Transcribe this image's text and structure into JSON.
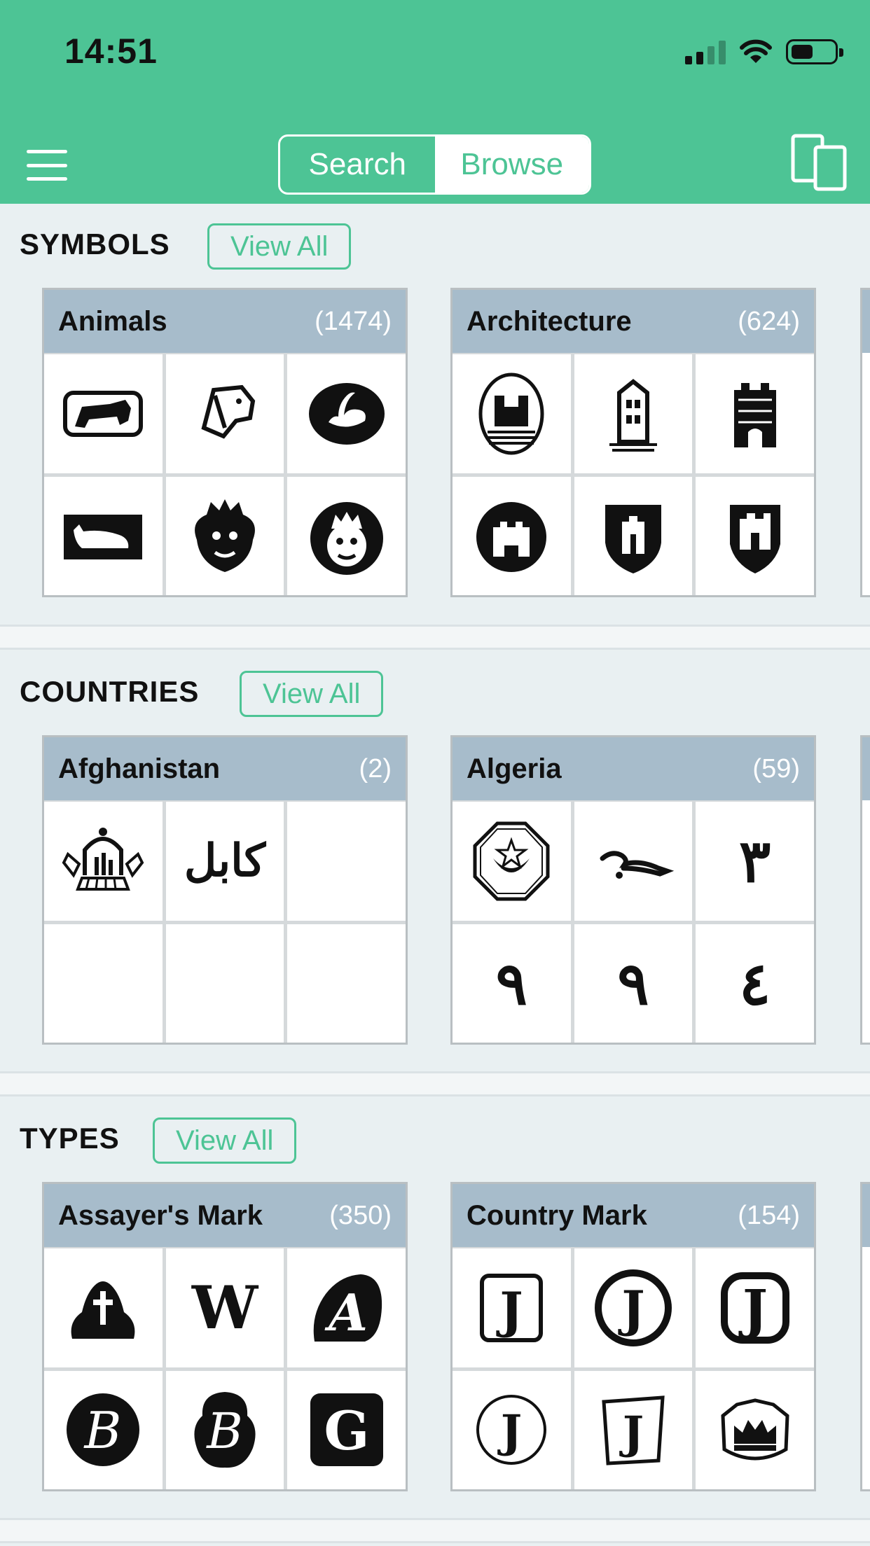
{
  "status": {
    "time": "14:51"
  },
  "header": {
    "segments": {
      "search_label": "Search",
      "browse_label": "Browse"
    }
  },
  "sections": [
    {
      "title": "SYMBOLS",
      "view_all": "View All",
      "cards": [
        {
          "name": "Animals",
          "count": "(1474)",
          "marks": [
            "lion-mark",
            "dog-head-mark",
            "swan-mark",
            "cat-mark",
            "crowned-lion-mark",
            "crowned-lion-head-mark"
          ]
        },
        {
          "name": "Architecture",
          "count": "(624)",
          "marks": [
            "towers-oval-mark",
            "building-mark",
            "castle-tower-mark",
            "castle-round-mark",
            "castle-shield-mark",
            "castle-shield-mark"
          ]
        }
      ]
    },
    {
      "title": "COUNTRIES",
      "view_all": "View All",
      "cards": [
        {
          "name": "Afghanistan",
          "count": "(2)",
          "marks": [
            "mosque-emblem-mark",
            "kabul-script-mark",
            "",
            "",
            "",
            ""
          ],
          "script_text": "كابل"
        },
        {
          "name": "Algeria",
          "count": "(59)",
          "marks": [
            "star-crescent-mark",
            "arabic-script-mark",
            "arabic-numeral-mark",
            "arabic-numeral-mark",
            "arabic-numeral-mark",
            "arabic-numeral-mark"
          ],
          "glyphs": [
            "",
            "~",
            "٣",
            "٩",
            "٩",
            "٤"
          ]
        }
      ]
    },
    {
      "title": "TYPES",
      "view_all": "View All",
      "cards": [
        {
          "name": "Assayer's Mark",
          "count": "(350)",
          "marks": [
            "cross-mark",
            "w-mark",
            "a-mark",
            "b-mark",
            "b-mark",
            "g-mark"
          ],
          "glyphs": [
            "",
            "W",
            "A",
            "B",
            "B",
            "G"
          ]
        },
        {
          "name": "Country Mark",
          "count": "(154)",
          "marks": [
            "j-mark",
            "j-mark",
            "j-mark",
            "j-mark",
            "j-mark",
            "crown-mark"
          ],
          "glyphs": [
            "J",
            "J",
            "J",
            "J",
            "J",
            ""
          ]
        }
      ]
    }
  ],
  "icons": {
    "menu": "hamburger-menu-icon",
    "device": "device-toggle-icon",
    "signal": "cellular-signal-icon",
    "wifi": "wifi-icon",
    "battery": "battery-icon"
  },
  "colors": {
    "accent": "#4dc495",
    "card_header": "#a7bccb",
    "background": "#e9f0f2"
  }
}
